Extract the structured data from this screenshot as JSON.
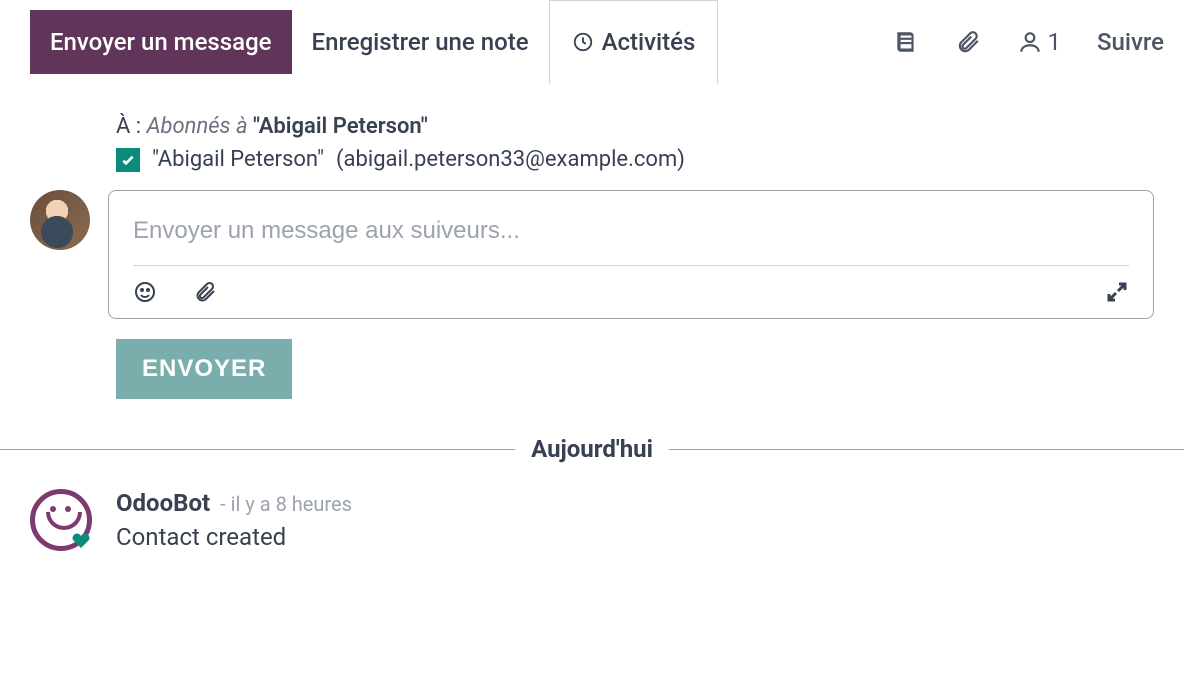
{
  "tabs": {
    "send_message": "Envoyer un message",
    "log_note": "Enregistrer une note",
    "activities": "Activités"
  },
  "toolbar": {
    "follower_count": "1",
    "follow": "Suivre"
  },
  "recipients": {
    "to_prefix": "À : ",
    "followers_of": "Abonnés à ",
    "record_name": "\"Abigail Peterson\"",
    "items": [
      {
        "name": "\"Abigail Peterson\"",
        "email": "(abigail.peterson33@example.com)"
      }
    ]
  },
  "compose": {
    "placeholder": "Envoyer un message aux suiveurs...",
    "send": "ENVOYER"
  },
  "feed": {
    "today": "Aujourd'hui",
    "messages": [
      {
        "author": "OdooBot",
        "time": "- il y a 8 heures",
        "body": "Contact created"
      }
    ]
  }
}
